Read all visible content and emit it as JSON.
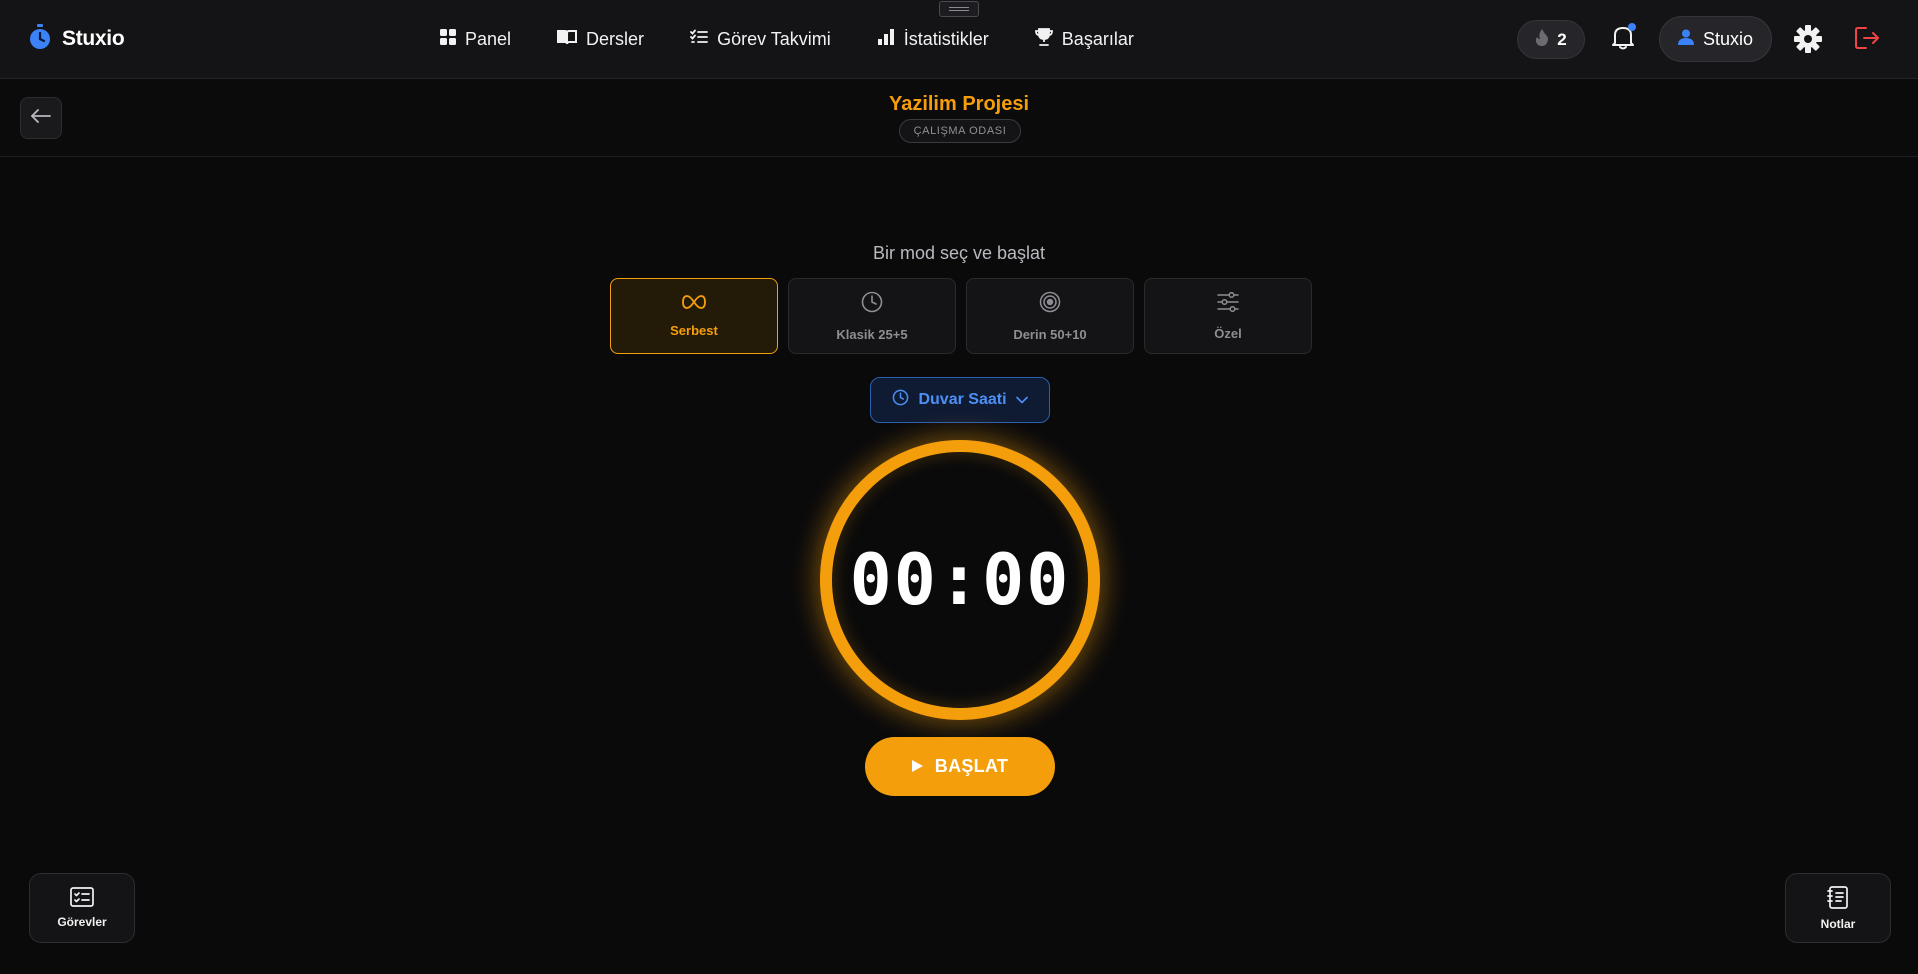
{
  "brand": {
    "name": "Stuxio",
    "logo_icon": "stopwatch-icon",
    "accent": "#3b82f6"
  },
  "nav": [
    {
      "label": "Panel",
      "icon": "grid-icon"
    },
    {
      "label": "Dersler",
      "icon": "book-icon"
    },
    {
      "label": "Görev Takvimi",
      "icon": "checklist-icon"
    },
    {
      "label": "İstatistikler",
      "icon": "bar-chart-icon"
    },
    {
      "label": "Başarılar",
      "icon": "trophy-icon"
    }
  ],
  "header": {
    "streak_count": "2",
    "streak_icon": "flame-icon",
    "notification_icon": "bell-icon",
    "user_name": "Stuxio",
    "settings_icon": "gear-icon",
    "logout_icon": "logout-icon"
  },
  "room": {
    "title": "Yazilim Projesi",
    "badge": "ÇALIŞMA ODASI",
    "back_icon": "arrow-left-icon",
    "accent": "#f59e0b"
  },
  "mode_picker": {
    "prompt": "Bir mod seç ve başlat",
    "modes": [
      {
        "label": "Serbest",
        "icon": "infinity-icon",
        "active": true
      },
      {
        "label": "Klasik 25+5",
        "icon": "clock-icon",
        "active": false
      },
      {
        "label": "Derin 50+10",
        "icon": "target-icon",
        "active": false
      },
      {
        "label": "Özel",
        "icon": "sliders-icon",
        "active": false
      }
    ]
  },
  "clock_style": {
    "label": "Duvar Saati",
    "icon": "clock-icon",
    "chevron": "chevron-down-icon"
  },
  "timer": {
    "display": "00:00"
  },
  "start_button": {
    "label": "BAŞLAT",
    "icon": "play-icon"
  },
  "floating": {
    "tasks": {
      "label": "Görevler",
      "icon": "task-list-icon"
    },
    "notes": {
      "label": "Notlar",
      "icon": "notebook-icon"
    }
  }
}
